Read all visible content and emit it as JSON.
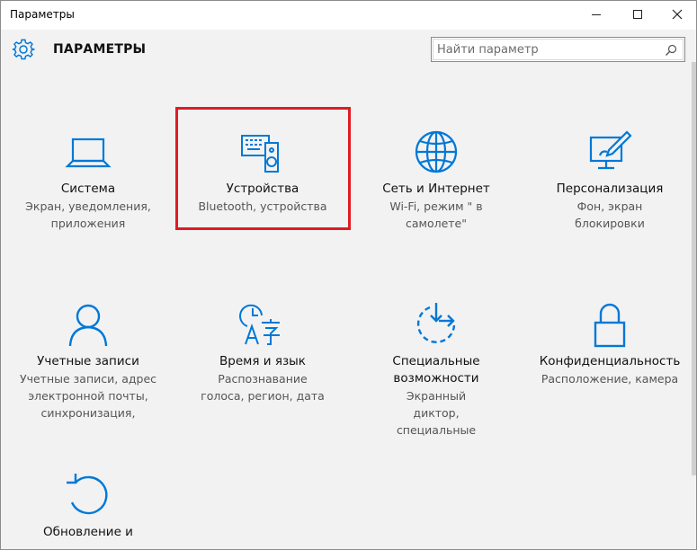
{
  "window": {
    "title": "Параметры"
  },
  "header": {
    "title": "ПАРАМЕТРЫ"
  },
  "search": {
    "placeholder": "Найти параметр"
  },
  "tiles": [
    {
      "name": "Система",
      "desc": "Экран, уведомления, приложения",
      "icon": "laptop-icon"
    },
    {
      "name": "Устройства",
      "desc": "Bluetooth, устройства",
      "icon": "devices-icon"
    },
    {
      "name": "Сеть и Интернет",
      "desc": "Wi-Fi, режим \" в самолете\"",
      "icon": "globe-icon"
    },
    {
      "name": "Персонализация",
      "desc": "Фон, экран блокировки",
      "icon": "personalization-icon"
    },
    {
      "name": "Учетные записи",
      "desc": "Учетные записи, адрес электронной почты, синхронизация,",
      "icon": "person-icon"
    },
    {
      "name": "Время и язык",
      "desc": "Распознавание голоса, регион, дата",
      "icon": "time-language-icon"
    },
    {
      "name": "Специальные возможности",
      "desc": "Экранный диктор, специальные",
      "icon": "ease-of-access-icon"
    },
    {
      "name": "Конфиденциальность",
      "desc": "Расположение, камера",
      "icon": "lock-icon"
    },
    {
      "name": "Обновление и",
      "desc": "",
      "icon": "update-icon"
    }
  ],
  "colors": {
    "accent": "#0078d7",
    "highlight": "#e01b24",
    "background": "#f2f2f2"
  }
}
